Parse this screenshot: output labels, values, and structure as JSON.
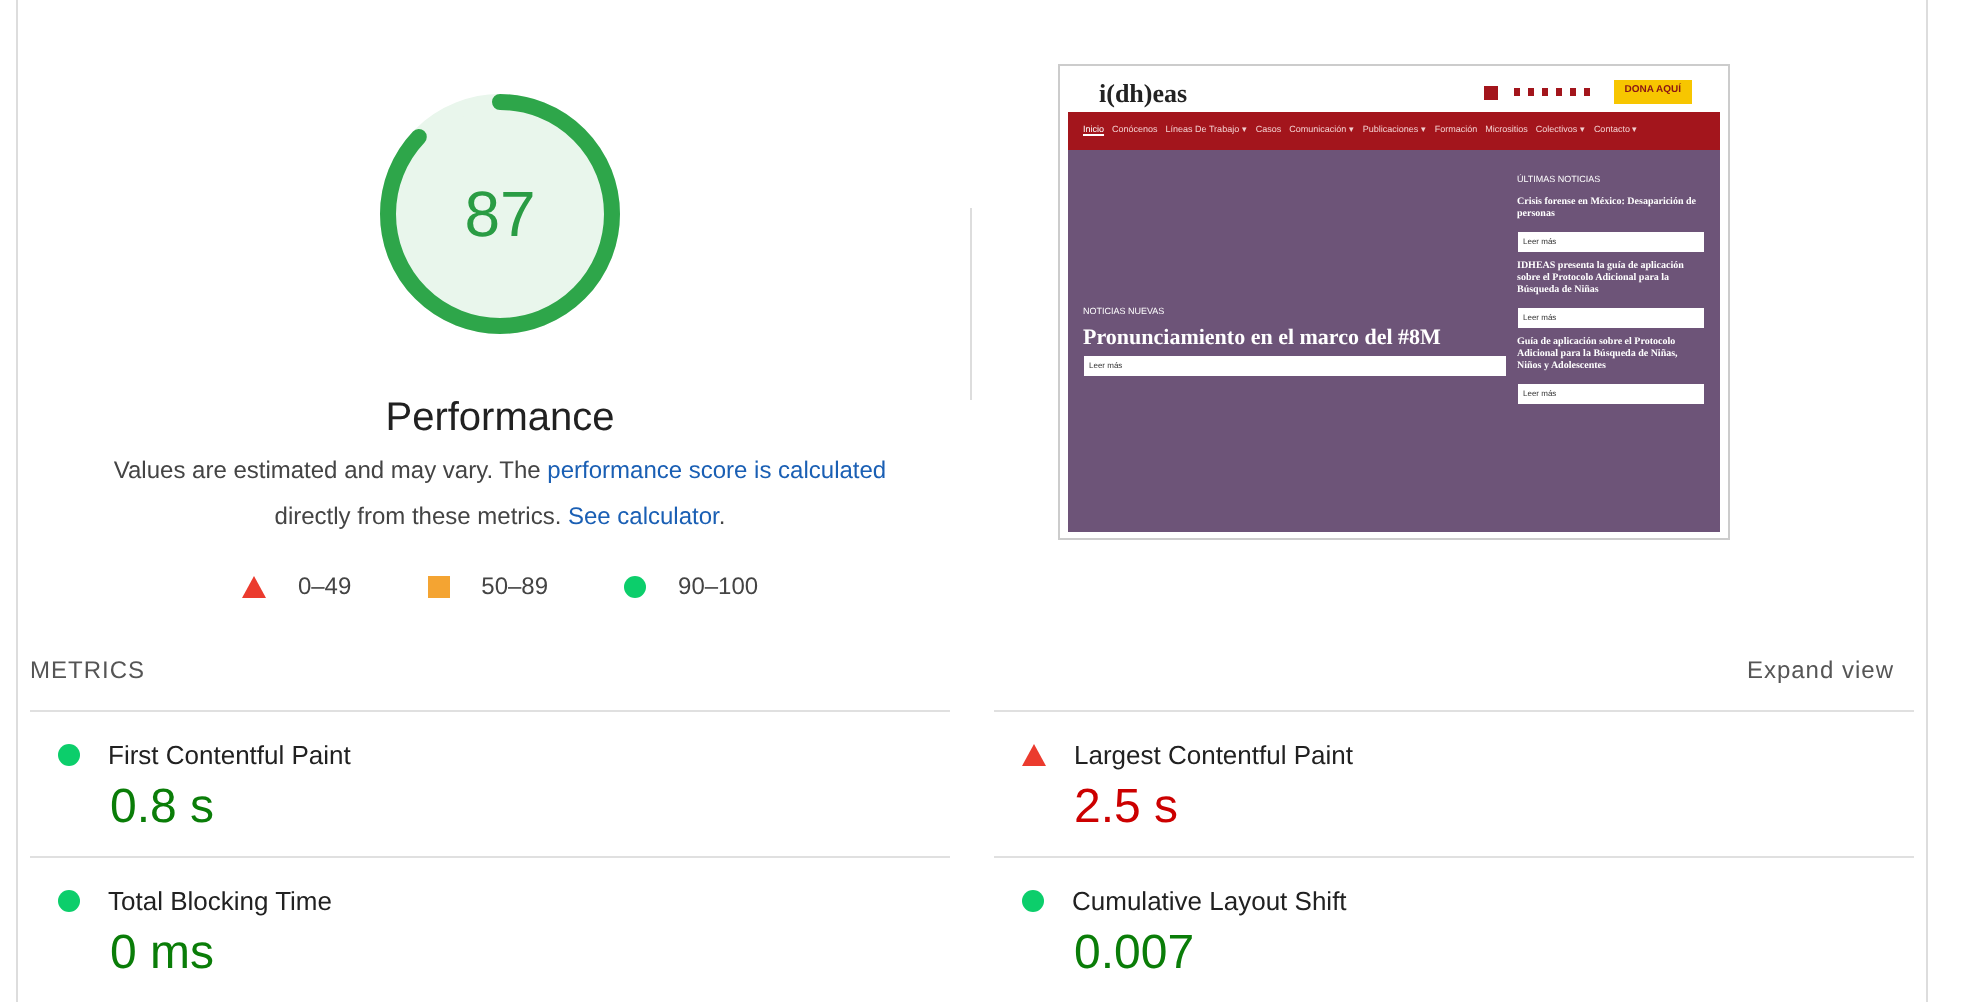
{
  "gauge": {
    "score": "87",
    "level": 0.87,
    "label": "Performance"
  },
  "description": {
    "text": "Values are estimated and may vary. The ",
    "link1": "performance score is calculated",
    "middle": " directly from these metrics. ",
    "link2": "See calculator",
    "end": "."
  },
  "legend": [
    {
      "kind": "fail",
      "range": "0–49"
    },
    {
      "kind": "average",
      "range": "50–89"
    },
    {
      "kind": "pass",
      "range": "90–100"
    }
  ],
  "screenshot": {
    "logo": "i(dh)eas",
    "donate": "DONA AQUÍ",
    "nav": [
      {
        "label": "Inicio",
        "selected": true
      },
      {
        "label": "Conócenos",
        "selected": false
      },
      {
        "label": "Líneas De Trabajo ▾",
        "selected": false
      },
      {
        "label": "Casos",
        "selected": false
      },
      {
        "label": "Comunicación ▾",
        "selected": false
      },
      {
        "label": "Publicaciones ▾",
        "selected": false
      },
      {
        "label": "Formación",
        "selected": false
      },
      {
        "label": "Micrositios",
        "selected": false
      },
      {
        "label": "Colectivos ▾",
        "selected": false
      },
      {
        "label": "Contacto ▾",
        "selected": false
      }
    ],
    "hero_tag": "NOTICIAS NUEVAS",
    "hero_title": "Pronunciamiento en el marco del #8M",
    "hero_button": "Leer más",
    "sidebar_title": "ÚLTIMAS NOTICIAS",
    "news": [
      {
        "title": "Crisis forense en México: Desaparición de personas",
        "button": "Leer más"
      },
      {
        "title": "IDHEAS presenta la guía de aplicación sobre el Protocolo Adicional para la Búsqueda de Niñas",
        "button": "Leer más"
      },
      {
        "title": "Guía de aplicación sobre el Protocolo Adicional para la Búsqueda de Niñas, Niños y Adolescentes",
        "button": "Leer más"
      }
    ]
  },
  "metrics": {
    "heading": "METRICS",
    "toggle": "Expand view",
    "items": [
      {
        "kind": "pass",
        "name": "First Contentful Paint",
        "value": "0.8 s"
      },
      {
        "kind": "fail",
        "name": "Largest Contentful Paint",
        "value": "2.5 s"
      },
      {
        "kind": "pass",
        "name": "Total Blocking Time",
        "value": "0 ms"
      },
      {
        "kind": "pass",
        "name": "Cumulative Layout Shift",
        "value": "0.007"
      }
    ]
  }
}
